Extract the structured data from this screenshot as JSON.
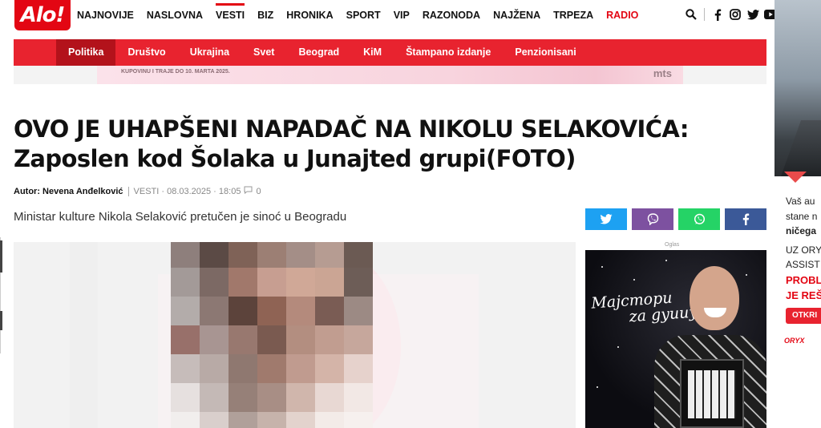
{
  "logo": "Alo!",
  "main_nav": [
    {
      "label": "NAJNOVIJE"
    },
    {
      "label": "NASLOVNA"
    },
    {
      "label": "VESTI",
      "active": true
    },
    {
      "label": "BIZ"
    },
    {
      "label": "HRONIKA"
    },
    {
      "label": "SPORT"
    },
    {
      "label": "VIP"
    },
    {
      "label": "RAZONODA"
    },
    {
      "label": "NAJŽENA"
    },
    {
      "label": "TRPEZA"
    },
    {
      "label": "RADIO",
      "highlight": true
    }
  ],
  "nav_icons": [
    "search-icon",
    "facebook-icon",
    "instagram-icon",
    "twitter-icon",
    "youtube-icon"
  ],
  "categories": [
    {
      "label": "Politika",
      "active": true
    },
    {
      "label": "Društvo"
    },
    {
      "label": "Ukrajina"
    },
    {
      "label": "Svet"
    },
    {
      "label": "Beograd"
    },
    {
      "label": "KiM"
    },
    {
      "label": "Štampano izdanje"
    },
    {
      "label": "Penzionisani"
    }
  ],
  "banner_ad": {
    "text": "KUPOVINU I TRAJE DO 10. MARTA 2025.",
    "brand": "mts"
  },
  "article": {
    "headline_line1": "OVO JE UHAPŠENI NAPADAČ NA NIKOLU SELAKOVIĆA:",
    "headline_line2": "Zaposlen kod Šolaka u Junajted grupi(FOTO)",
    "author": "Autor: Nevena Anđelković",
    "section_date": "VESTI · 08.03.2025 · 18:05",
    "comments": "0",
    "lead": "Ministar kulture Nikola Selaković pretučen je sinoć u Beogradu"
  },
  "share_buttons": [
    {
      "network": "twitter",
      "icon": "twitter-icon",
      "color": "#1da1f2"
    },
    {
      "network": "viber",
      "icon": "viber-icon",
      "color": "#7d51a0"
    },
    {
      "network": "whatsapp",
      "icon": "whatsapp-icon",
      "color": "#25d366"
    },
    {
      "network": "facebook",
      "icon": "facebook-icon",
      "color": "#3b5998"
    }
  ],
  "sidebar_ad": {
    "label": "Oglas",
    "script_line1": "Majcmopu",
    "script_line2": "za gyuuy"
  },
  "right_ad": {
    "line1": "Vaš au",
    "line2": "stane n",
    "line3": "ničega",
    "line4": "UZ ORY",
    "line5": "ASSIST",
    "line6": "PROBL",
    "line7": "JE REŠ",
    "button": "OTKRI",
    "brand": "ORYX"
  },
  "colors": {
    "brand_red": "#e30613",
    "category_bar": "#e8232f",
    "category_active": "#b3121b"
  }
}
